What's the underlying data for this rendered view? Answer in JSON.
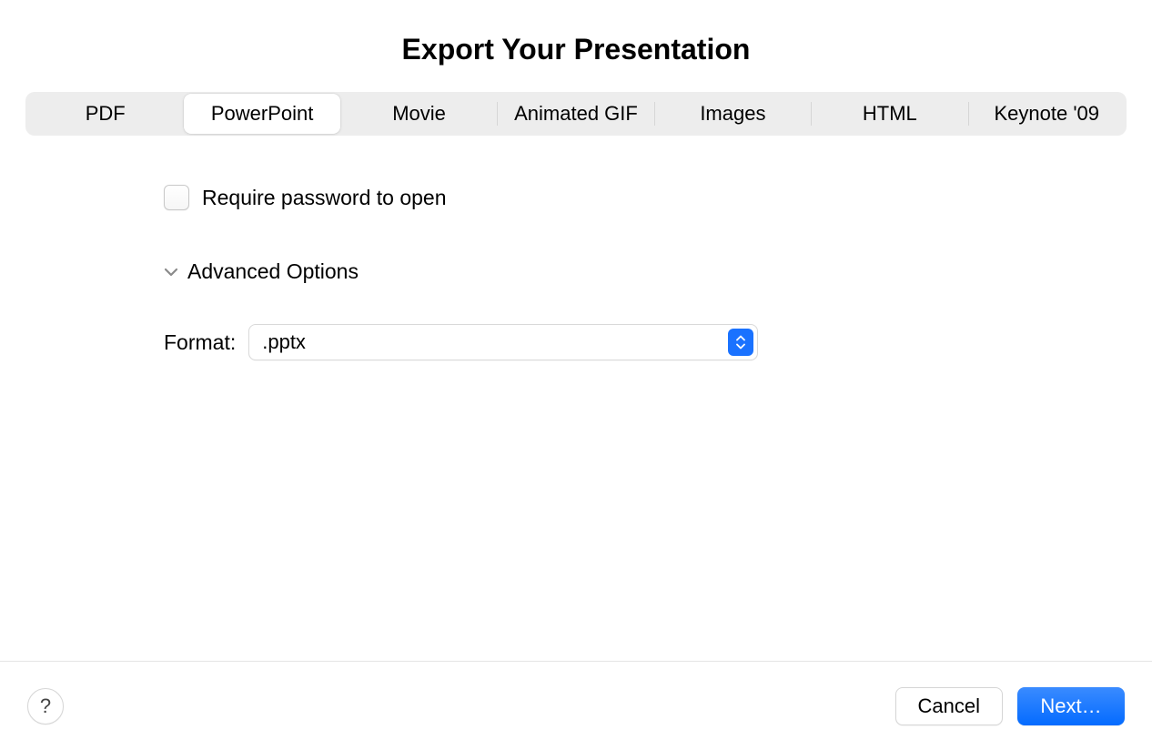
{
  "dialog": {
    "title": "Export Your Presentation"
  },
  "tabs": {
    "items": [
      {
        "label": "PDF"
      },
      {
        "label": "PowerPoint"
      },
      {
        "label": "Movie"
      },
      {
        "label": "Animated GIF"
      },
      {
        "label": "Images"
      },
      {
        "label": "HTML"
      },
      {
        "label": "Keynote '09"
      }
    ],
    "activeIndex": 1
  },
  "options": {
    "require_password_label": "Require password to open",
    "advanced_label": "Advanced Options",
    "format_label": "Format:",
    "format_value": ".pptx"
  },
  "footer": {
    "help_glyph": "?",
    "cancel_label": "Cancel",
    "next_label": "Next…"
  }
}
